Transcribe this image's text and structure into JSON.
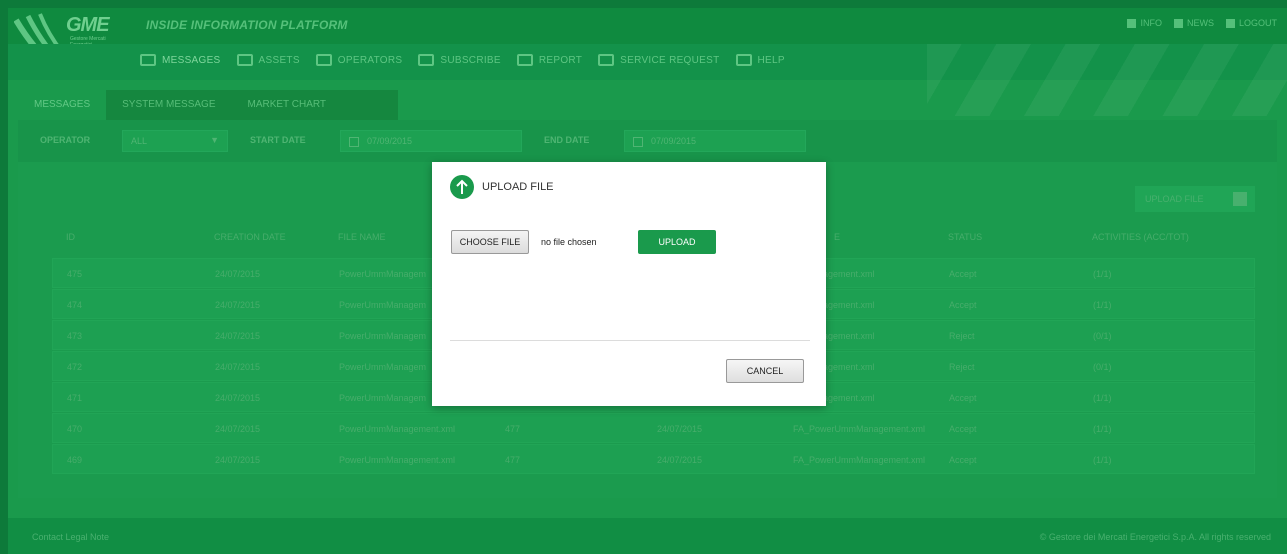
{
  "header": {
    "logo_text": "GME",
    "logo_sub": "Gestore Mercati Energetici",
    "platform_title": "INSIDE INFORMATION PLATFORM",
    "links": [
      "INFO",
      "NEWS",
      "LOGOUT"
    ]
  },
  "nav": {
    "items": [
      "MESSAGES",
      "ASSETS",
      "OPERATORS",
      "SUBSCRIBE",
      "REPORT",
      "SERVICE REQUEST",
      "HELP"
    ]
  },
  "subtabs": [
    "MESSAGES",
    "SYSTEM MESSAGE",
    "MARKET CHART"
  ],
  "filters": {
    "operator_label": "OPERATOR",
    "operator_value": "ALL",
    "start_label": "START DATE",
    "start_value": "07/09/2015",
    "end_label": "END DATE",
    "end_value": "07/09/2015"
  },
  "upload_button_label": "UPLOAD FILE",
  "table": {
    "headers": [
      "ID",
      "CREATION DATE",
      "FILE NAME",
      "",
      "",
      "E",
      "STATUS",
      "ACTIVITIES (ACC/TOT)"
    ],
    "rows": [
      {
        "id": "475",
        "date": "24/07/2015",
        "file": "PowerUmmManagem",
        "c4": "",
        "c5": "",
        "file2": "nmManagement.xml",
        "status": "Accept",
        "act": "(1/1)"
      },
      {
        "id": "474",
        "date": "24/07/2015",
        "file": "PowerUmmManagem",
        "c4": "",
        "c5": "",
        "file2": "nmManagement.xml",
        "status": "Accept",
        "act": "(1/1)"
      },
      {
        "id": "473",
        "date": "24/07/2015",
        "file": "PowerUmmManagem",
        "c4": "",
        "c5": "",
        "file2": "nmManagement.xml",
        "status": "Reject",
        "act": "(0/1)"
      },
      {
        "id": "472",
        "date": "24/07/2015",
        "file": "PowerUmmManagem",
        "c4": "",
        "c5": "",
        "file2": "nmManagement.xml",
        "status": "Reject",
        "act": "(0/1)"
      },
      {
        "id": "471",
        "date": "24/07/2015",
        "file": "PowerUmmManagem",
        "c4": "",
        "c5": "",
        "file2": "nmManagement.xml",
        "status": "Accept",
        "act": "(1/1)"
      },
      {
        "id": "470",
        "date": "24/07/2015",
        "file": "PowerUmmManagement.xml",
        "c4": "477",
        "c5": "24/07/2015",
        "file2": "FA_PowerUmmManagement.xml",
        "status": "Accept",
        "act": "(1/1)"
      },
      {
        "id": "469",
        "date": "24/07/2015",
        "file": "PowerUmmManagement.xml",
        "c4": "477",
        "c5": "24/07/2015",
        "file2": "FA_PowerUmmManagement.xml",
        "status": "Accept",
        "act": "(1/1)"
      }
    ]
  },
  "footer": {
    "left": "Contact  Legal Note",
    "right": "© Gestore dei Mercati Energetici S.p.A. All rights reserved"
  },
  "modal": {
    "title": "UPLOAD FILE",
    "choose_label": "CHOOSE FILE",
    "file_status": "no file chosen",
    "upload_label": "UPLOAD",
    "cancel_label": "CANCEL"
  },
  "colors": {
    "brand_green": "#1a9a4c",
    "overlay_green": "#0d7a3a"
  }
}
